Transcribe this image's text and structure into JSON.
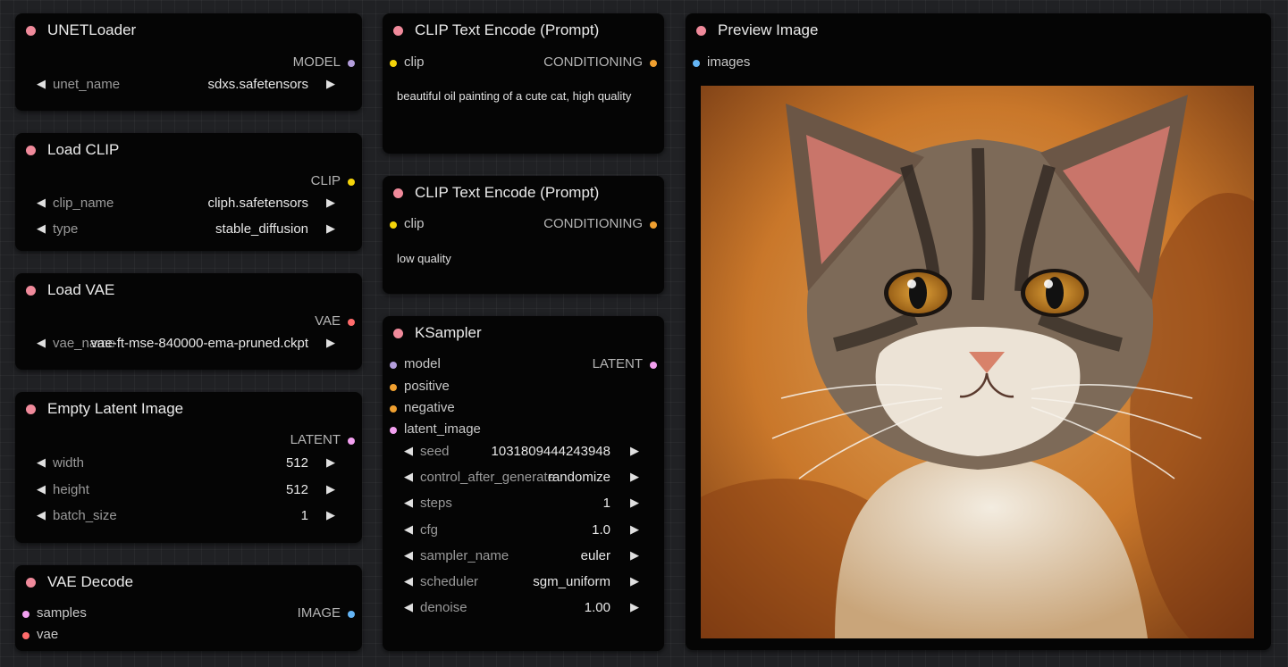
{
  "colors": {
    "model": "#b39ddb",
    "clip": "#f5d40a",
    "vae": "#ff6b6b",
    "conditioning": "#f0a030",
    "latent": "#f3a0f0",
    "image": "#64b5f6",
    "title_dot": "#f08a9b"
  },
  "nodes": {
    "unet_loader": {
      "title": "UNETLoader",
      "output": "MODEL",
      "widgets": [
        {
          "name": "unet_name",
          "value": "sdxs.safetensors"
        }
      ]
    },
    "load_clip": {
      "title": "Load CLIP",
      "output": "CLIP",
      "widgets": [
        {
          "name": "clip_name",
          "value": "cliph.safetensors"
        },
        {
          "name": "type",
          "value": "stable_diffusion"
        }
      ]
    },
    "load_vae": {
      "title": "Load VAE",
      "output": "VAE",
      "widgets": [
        {
          "name": "vae_name",
          "value": "vae-ft-mse-840000-ema-pruned.ckpt"
        }
      ]
    },
    "empty_latent": {
      "title": "Empty Latent Image",
      "output": "LATENT",
      "widgets": [
        {
          "name": "width",
          "value": "512"
        },
        {
          "name": "height",
          "value": "512"
        },
        {
          "name": "batch_size",
          "value": "1"
        }
      ]
    },
    "vae_decode": {
      "title": "VAE Decode",
      "inputs": [
        "samples",
        "vae"
      ],
      "output": "IMAGE"
    },
    "clip_pos": {
      "title": "CLIP Text Encode (Prompt)",
      "input": "clip",
      "output": "CONDITIONING",
      "text": "beautiful oil painting of a cute cat, high quality"
    },
    "clip_neg": {
      "title": "CLIP Text Encode (Prompt)",
      "input": "clip",
      "output": "CONDITIONING",
      "text": "low quality"
    },
    "ksampler": {
      "title": "KSampler",
      "inputs": [
        "model",
        "positive",
        "negative",
        "latent_image"
      ],
      "output": "LATENT",
      "widgets": [
        {
          "name": "seed",
          "value": "1031809444243948"
        },
        {
          "name": "control_after_generate",
          "value": "randomize"
        },
        {
          "name": "steps",
          "value": "1"
        },
        {
          "name": "cfg",
          "value": "1.0"
        },
        {
          "name": "sampler_name",
          "value": "euler"
        },
        {
          "name": "scheduler",
          "value": "sgm_uniform"
        },
        {
          "name": "denoise",
          "value": "1.00"
        }
      ]
    },
    "preview": {
      "title": "Preview Image",
      "input": "images"
    }
  },
  "glyphs": {
    "left": "◀",
    "right": "▶"
  }
}
